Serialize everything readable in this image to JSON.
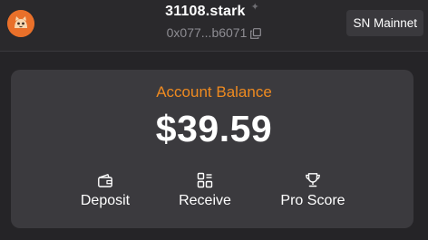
{
  "header": {
    "account_name": "31108.stark",
    "address": "0x077...b6071",
    "network_label": "SN Mainnet"
  },
  "balance": {
    "label": "Account Balance",
    "value": "$39.59"
  },
  "actions": [
    {
      "label": "Deposit",
      "icon": "wallet-icon"
    },
    {
      "label": "Receive",
      "icon": "qr-grid-icon"
    },
    {
      "label": "Pro Score",
      "icon": "trophy-icon"
    }
  ],
  "colors": {
    "accent": "#ee8a20",
    "background": "#252427",
    "card": "#3b3a3e",
    "avatar": "#e9702a"
  }
}
